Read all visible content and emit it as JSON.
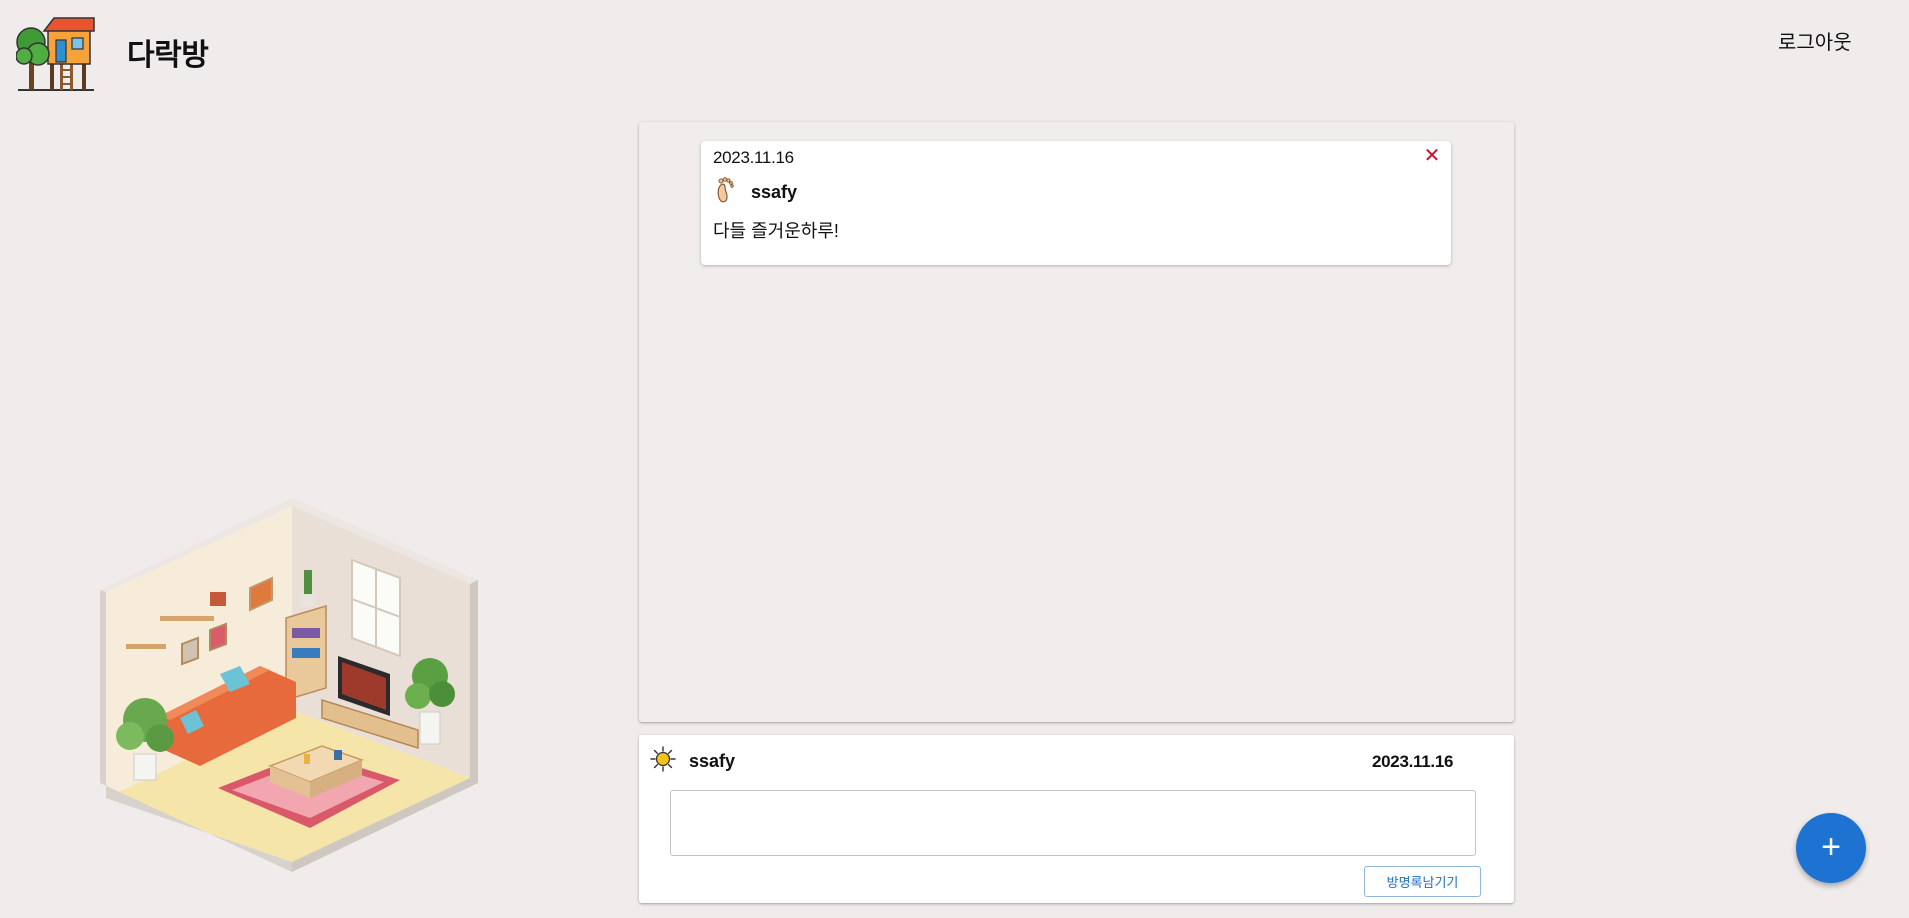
{
  "header": {
    "brand_title": "다락방",
    "logout_label": "로그아웃"
  },
  "guestbook": {
    "entries": [
      {
        "date": "2023.11.16",
        "username": "ssafy",
        "message": "다들 즐거운하루!",
        "avatar_icon": "footprint-icon",
        "delete_glyph": "✕"
      }
    ]
  },
  "composer": {
    "username": "ssafy",
    "date": "2023.11.16",
    "avatar_icon": "sun-icon",
    "input_value": "",
    "submit_label": "방명록남기기"
  },
  "fab": {
    "glyph": "+"
  },
  "colors": {
    "background": "#f1ecec",
    "accent_blue": "#1e73d2",
    "delete_red": "#c8102e"
  }
}
